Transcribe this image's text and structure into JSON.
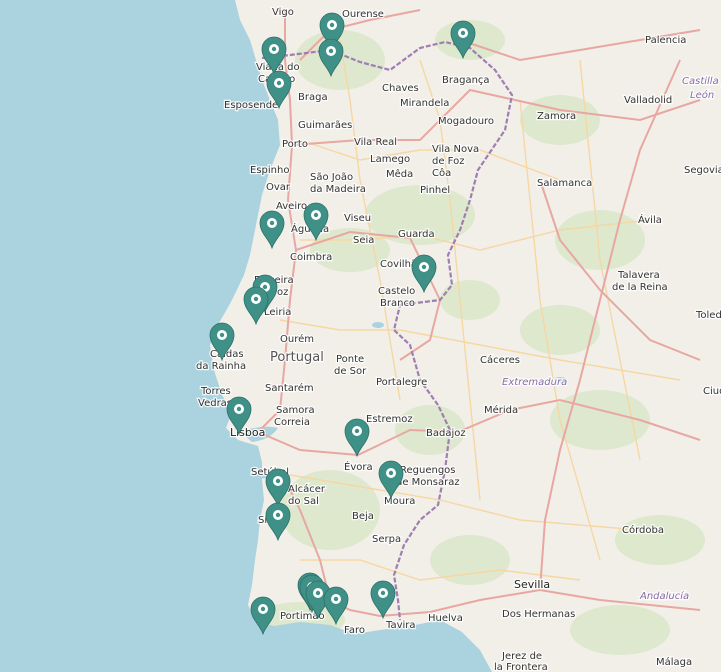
{
  "colors": {
    "sea": "#aad3df",
    "land": "#f2efe9",
    "green": "#d7e6c4",
    "border": "#9e7fb0",
    "road_major": "#e8a7a1",
    "road_minor": "#f6d7a2",
    "marker": "#3f9188",
    "marker_inner": "#ffffff"
  },
  "labels": {
    "vigo": "Vigo",
    "ourense": "Ourense",
    "palencia": "Palencia",
    "castilla_leon_1": "Castilla y",
    "castilla_leon_2": "León",
    "viana_1": "Viana do",
    "viana_2": "Castelo",
    "braga": "Braga",
    "chaves": "Chaves",
    "braganca": "Bragança",
    "valladolid": "Valladolid",
    "esposende": "Esposende",
    "mirandela": "Mirandela",
    "guimaraes": "Guimarães",
    "mogadouro": "Mogadouro",
    "zamora": "Zamora",
    "vila_real": "Vila Real",
    "porto": "Porto",
    "lamego": "Lamego",
    "vila_nova_1": "Vila Nova",
    "vila_nova_2": "de Foz",
    "vila_nova_3": "Côa",
    "espinho": "Espinho",
    "sao_joao_1": "São João",
    "sao_joao_2": "da Madeira",
    "meda": "Mêda",
    "ovar": "Ovar",
    "pinhel": "Pinhel",
    "salamanca": "Salamanca",
    "segovia": "Segovia",
    "aveiro": "Aveiro",
    "agueda": "Águeda",
    "viseu": "Viseu",
    "guarda": "Guarda",
    "avila": "Ávila",
    "seia": "Seia",
    "coimbra": "Coimbra",
    "covilha": "Covilhã",
    "talavera_1": "Talavera",
    "talavera_2": "de la Reina",
    "figueira_1": "Figueira",
    "figueira_2": "da Foz",
    "castelo_1": "Castelo",
    "castelo_2": "Branco",
    "leiria": "Leiria",
    "toledo": "Toledo",
    "ourem": "Ourém",
    "caldas_1": "Caldas",
    "caldas_2": "da Rainha",
    "portugal": "Portugal",
    "ponte_1": "Ponte",
    "ponte_2": "de Sor",
    "caceres": "Cáceres",
    "extremadura": "Extremadura",
    "torres_1": "Torres",
    "torres_2": "Vedras",
    "santarem": "Santarém",
    "portalegre": "Portalegre",
    "ciudad": "Ciud",
    "samora_1": "Samora",
    "samora_2": "Correia",
    "merida": "Mérida",
    "estremoz": "Estremoz",
    "lisboa": "Lisboa",
    "badajoz": "Badajoz",
    "setubal": "Setúbal",
    "evora": "Évora",
    "reguengos_1": "Reguengos",
    "reguengos_2": "de Monsaraz",
    "alcacer_1": "Alcácer",
    "alcacer_2": "do Sal",
    "moura": "Moura",
    "sines": "Sines",
    "beja": "Beja",
    "cordoba": "Córdoba",
    "serpa": "Serpa",
    "sevilla": "Sevilla",
    "portimao": "Portimão",
    "faro": "Faro",
    "tavira": "Tavira",
    "huelva": "Huelva",
    "dos_hermanas": "Dos Hermanas",
    "andalucia": "Andalucía",
    "jerez_1": "Jerez de",
    "jerez_2": "la Frontera",
    "malaga": "Málaga"
  },
  "markers": [
    "location-marker",
    "location-marker",
    "location-marker",
    "location-marker",
    "location-marker",
    "location-marker",
    "location-marker",
    "location-marker",
    "location-marker",
    "location-marker",
    "location-marker",
    "location-marker",
    "location-marker",
    "location-marker",
    "location-marker",
    "location-marker",
    "location-marker",
    "location-marker",
    "location-marker",
    "location-marker",
    "location-marker",
    "location-marker"
  ]
}
